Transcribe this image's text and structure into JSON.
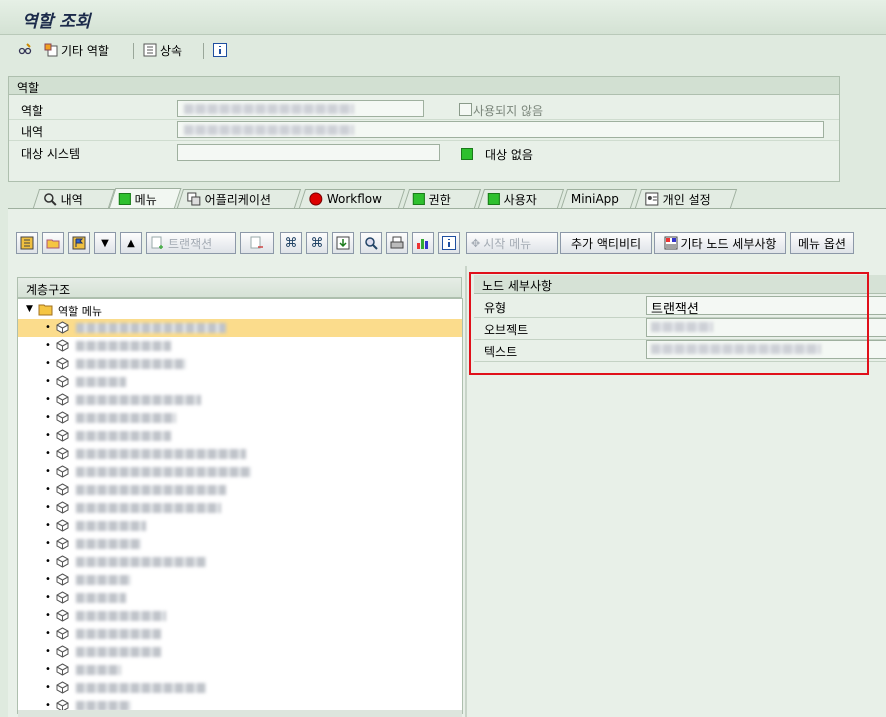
{
  "window": {
    "title": "역할 조회"
  },
  "app_toolbar": {
    "other_role_label": "기타 역할",
    "inherit_label": "상속"
  },
  "header_frame": {
    "title": "역할",
    "role_label": "역할",
    "description_label": "내역",
    "target_system_label": "대상 시스템",
    "not_used_label": "사용되지 않음",
    "no_target_label": "대상 없음"
  },
  "tabs": [
    {
      "label": "내역"
    },
    {
      "label": "메뉴"
    },
    {
      "label": "어플리케이션"
    },
    {
      "label": "Workflow"
    },
    {
      "label": "권한"
    },
    {
      "label": "사용자"
    },
    {
      "label": "MiniApp"
    },
    {
      "label": "개인 설정"
    }
  ],
  "menu_toolbar": {
    "transaction_label": "트랜잭션",
    "start_menu_label": "시작 메뉴",
    "add_activity_label": "추가 액티비티",
    "other_node_details_label": "기타 노드 세부사항",
    "menu_options_label": "메뉴 옵션"
  },
  "tree": {
    "header": "계층구조",
    "root_label": "역할 메뉴"
  },
  "node_details": {
    "header": "노드 세부사항",
    "type_label": "유형",
    "type_value": "트랜잭션",
    "object_label": "오브젝트",
    "text_label": "텍스트"
  },
  "colors": {
    "status_green": "#2ec02e",
    "selection": "#fbdc8c",
    "highlight_box": "#e0101a",
    "background": "#dfeadf"
  }
}
